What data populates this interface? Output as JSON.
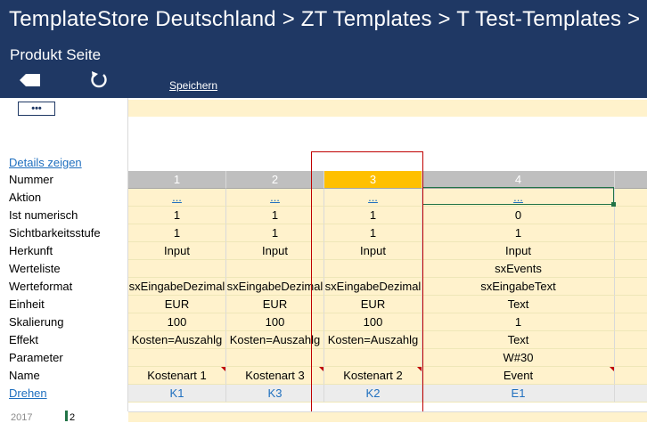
{
  "header": {
    "breadcrumb": "TemplateStore Deutschland > ZT  Templates > T  Test-Templates >",
    "page_title": "Produkt Seite",
    "save_label": "Speichern",
    "more_label": "•••",
    "bg_color": "#1f3864"
  },
  "rows": {
    "details": "Details zeigen",
    "nummer": "Nummer",
    "aktion": "Aktion",
    "ist_numerisch": "Ist numerisch",
    "sichtbarkeit": "Sichtbarkeitsstufe",
    "herkunft": "Herkunft",
    "werteliste": "Werteliste",
    "werteformat": "Werteformat",
    "einheit": "Einheit",
    "skalierung": "Skalierung",
    "effekt": "Effekt",
    "parameter": "Parameter",
    "name": "Name",
    "drehen": "Drehen"
  },
  "columns": [
    {
      "nummer": "1",
      "aktion": "...",
      "ist_numerisch": "1",
      "sichtbarkeit": "1",
      "herkunft": "Input",
      "werteliste": "",
      "werteformat": "sxEingabeDezimal",
      "einheit": "EUR",
      "skalierung": "100",
      "effekt": "Kosten=Auszahlg",
      "parameter": "",
      "name": "Kostenart 1",
      "key": "K1"
    },
    {
      "nummer": "2",
      "aktion": "...",
      "ist_numerisch": "1",
      "sichtbarkeit": "1",
      "herkunft": "Input",
      "werteliste": "",
      "werteformat": "sxEingabeDezimal",
      "einheit": "EUR",
      "skalierung": "100",
      "effekt": "Kosten=Auszahlg",
      "parameter": "",
      "name": "Kostenart 3",
      "key": "K3"
    },
    {
      "nummer": "3",
      "aktion": "...",
      "ist_numerisch": "1",
      "sichtbarkeit": "1",
      "herkunft": "Input",
      "werteliste": "",
      "werteformat": "sxEingabeDezimal",
      "einheit": "EUR",
      "skalierung": "100",
      "effekt": "Kosten=Auszahlg",
      "parameter": "",
      "name": "Kostenart 2",
      "key": "K2"
    },
    {
      "nummer": "4",
      "aktion": "...",
      "ist_numerisch": "0",
      "sichtbarkeit": "1",
      "herkunft": "Input",
      "werteliste": "sxEvents",
      "werteformat": "sxEingabeText",
      "einheit": "Text",
      "skalierung": "1",
      "effekt": "Text",
      "parameter": "W#30",
      "name": "Event",
      "key": "E1"
    }
  ],
  "bottom": {
    "year": "2017",
    "num": "2"
  },
  "colors": {
    "accent": "#ffc000",
    "cell_bg": "#fff2cc",
    "link": "#1f6fbf",
    "highlight_frame": "#c00000"
  }
}
